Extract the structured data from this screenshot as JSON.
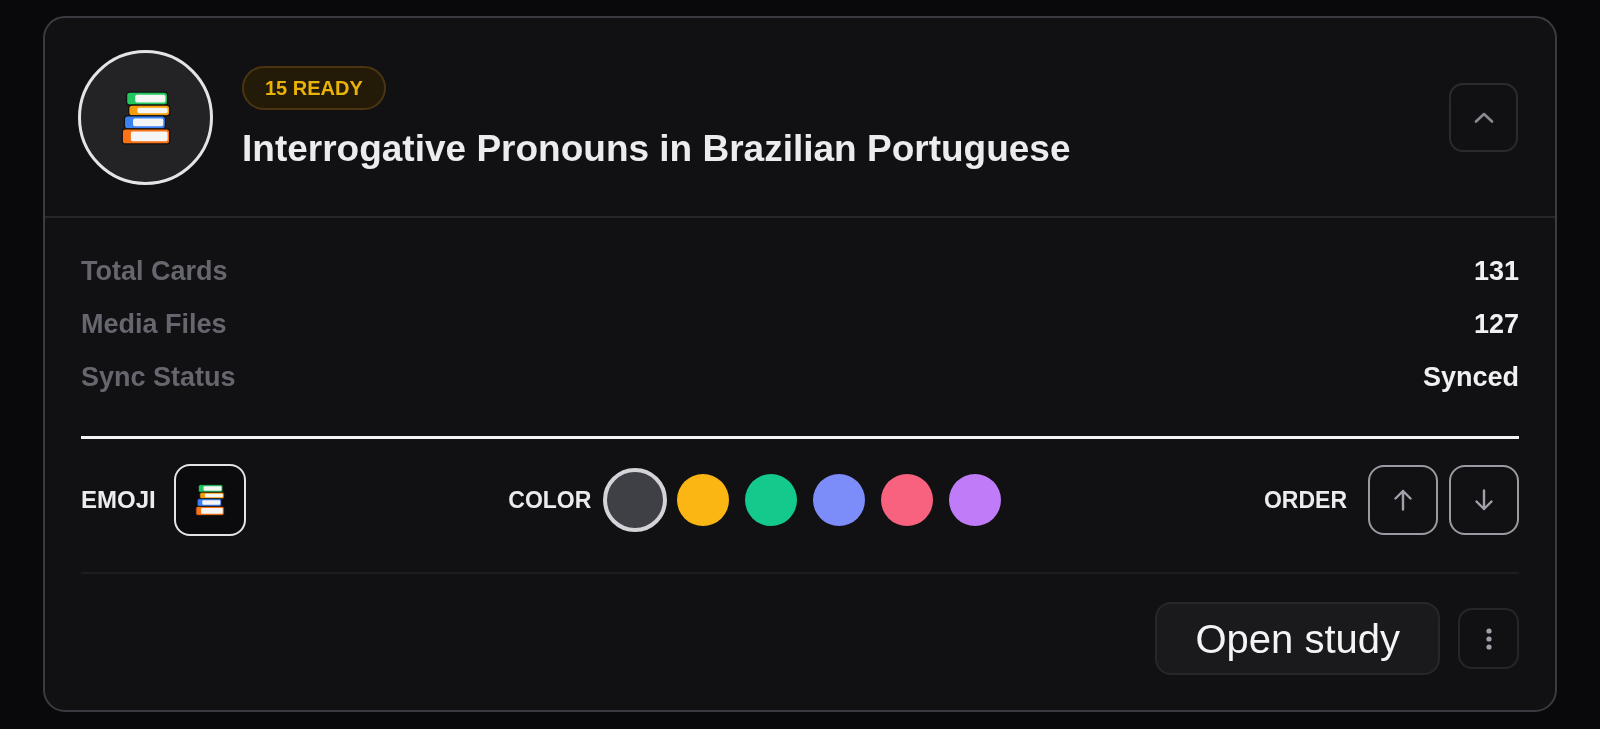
{
  "deck": {
    "badge": "15 READY",
    "title": "Interrogative Pronouns in Brazilian Portuguese",
    "expanded": true
  },
  "stats": [
    {
      "label": "Total Cards",
      "value": "131"
    },
    {
      "label": "Media Files",
      "value": "127"
    },
    {
      "label": "Sync Status",
      "value": "Synced"
    }
  ],
  "settings": {
    "emoji_label": "EMOJI",
    "color_label": "COLOR",
    "colors": [
      {
        "color": "#3f3f46",
        "selected": true
      },
      {
        "color": "#fbb614",
        "selected": false
      },
      {
        "color": "#14c98c",
        "selected": false
      },
      {
        "color": "#7c8cf8",
        "selected": false
      },
      {
        "color": "#f9627f",
        "selected": false
      },
      {
        "color": "#c07cf8",
        "selected": false
      }
    ],
    "order_label": "ORDER"
  },
  "actions": {
    "primary": "Open study"
  }
}
